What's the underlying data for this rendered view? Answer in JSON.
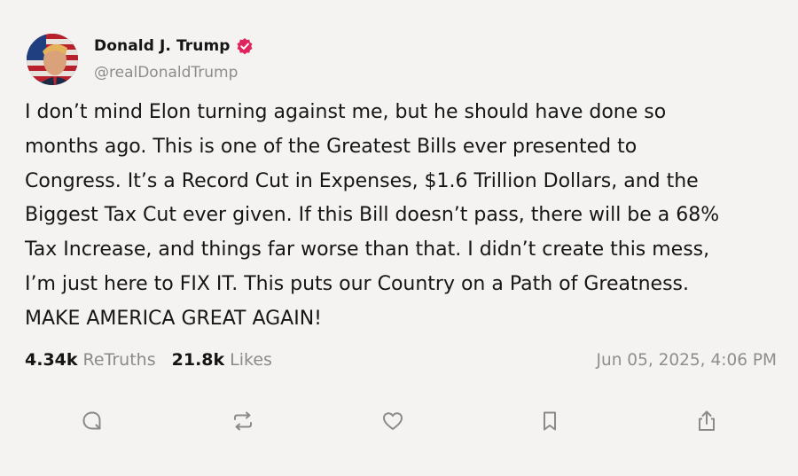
{
  "author": {
    "display_name": "Donald J. Trump",
    "handle": "@realDonaldTrump",
    "verified_color": "#e0245e",
    "avatar_icon": "avatar-portrait-flag"
  },
  "post": {
    "lines": [
      "I don’t mind Elon turning against me, but he should have done so",
      "months ago. This is one of the Greatest Bills ever presented to",
      "Congress. It’s a Record Cut in Expenses, $1.6 Trillion Dollars, and the",
      "Biggest Tax Cut ever given. If this Bill doesn’t pass, there will be a 68%",
      "Tax Increase, and things far worse than that. I didn’t create this mess,",
      "I’m just here to FIX IT. This puts our Country on a Path of Greatness.",
      "MAKE AMERICA GREAT AGAIN!"
    ]
  },
  "stats": {
    "retruths_count": "4.34k",
    "retruths_label": "ReTruths",
    "likes_count": "21.8k",
    "likes_label": "Likes",
    "timestamp": "Jun 05, 2025, 4:06 PM"
  },
  "actions": [
    {
      "name": "reply",
      "icon": "comment-bubble-icon"
    },
    {
      "name": "retruth",
      "icon": "repost-arrows-icon"
    },
    {
      "name": "like",
      "icon": "heart-icon"
    },
    {
      "name": "bookmark",
      "icon": "bookmark-icon"
    },
    {
      "name": "share",
      "icon": "share-icon"
    }
  ],
  "colors": {
    "background": "#f4f3f1",
    "text": "#161616",
    "muted": "#8c8c8c",
    "icon": "#8a8a8a"
  }
}
